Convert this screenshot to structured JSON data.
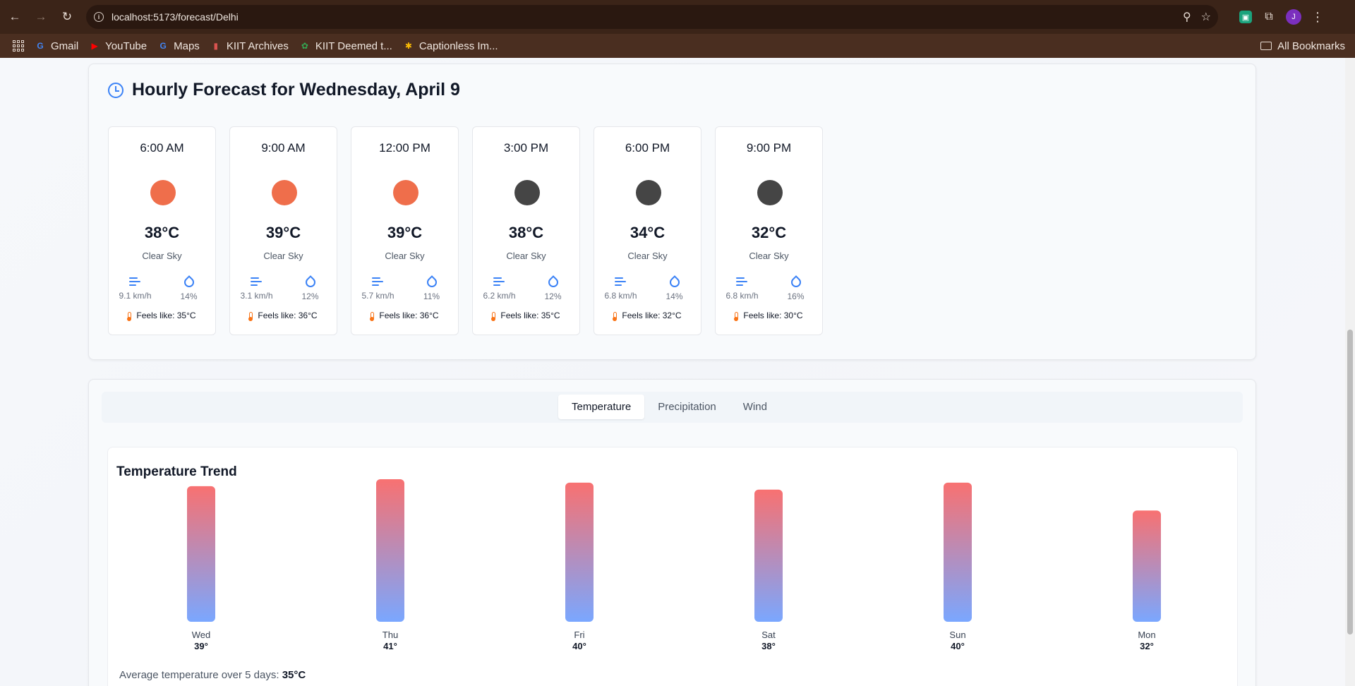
{
  "browser": {
    "url": "localhost:5173/forecast/Delhi",
    "avatar_initial": "J",
    "bookmarks": [
      {
        "label": "Gmail",
        "icon": "google-icon",
        "color": "#4285f4",
        "glyph": "G"
      },
      {
        "label": "YouTube",
        "icon": "youtube-icon",
        "color": "#ff0000",
        "glyph": "▶"
      },
      {
        "label": "Maps",
        "icon": "google-icon",
        "color": "#4285f4",
        "glyph": "G"
      },
      {
        "label": "KIIT Archives",
        "icon": "kiit-icon",
        "color": "#d9534f",
        "glyph": "▮"
      },
      {
        "label": "KIIT Deemed t...",
        "icon": "kiit-icon",
        "color": "#34a853",
        "glyph": "✿"
      },
      {
        "label": "Captionless Im...",
        "icon": "pinwheel-icon",
        "color": "#fbbc05",
        "glyph": "✱"
      }
    ],
    "all_bookmarks": "All Bookmarks"
  },
  "hourly": {
    "title": "Hourly Forecast for Wednesday, April 9",
    "items": [
      {
        "time": "6:00 AM",
        "temp": "38°C",
        "cond": "Clear Sky",
        "wind": "9.1 km/h",
        "humidity": "14%",
        "feels": "Feels like: 35°C",
        "icon": "sun-icon",
        "icon_color": "#ef6e4b"
      },
      {
        "time": "9:00 AM",
        "temp": "39°C",
        "cond": "Clear Sky",
        "wind": "3.1 km/h",
        "humidity": "12%",
        "feels": "Feels like: 36°C",
        "icon": "sun-icon",
        "icon_color": "#ef6e4b"
      },
      {
        "time": "12:00 PM",
        "temp": "39°C",
        "cond": "Clear Sky",
        "wind": "5.7 km/h",
        "humidity": "11%",
        "feels": "Feels like: 36°C",
        "icon": "sun-icon",
        "icon_color": "#ef6e4b"
      },
      {
        "time": "3:00 PM",
        "temp": "38°C",
        "cond": "Clear Sky",
        "wind": "6.2 km/h",
        "humidity": "12%",
        "feels": "Feels like: 35°C",
        "icon": "moon-icon",
        "icon_color": "#454545"
      },
      {
        "time": "6:00 PM",
        "temp": "34°C",
        "cond": "Clear Sky",
        "wind": "6.8 km/h",
        "humidity": "14%",
        "feels": "Feels like: 32°C",
        "icon": "moon-icon",
        "icon_color": "#454545"
      },
      {
        "time": "9:00 PM",
        "temp": "32°C",
        "cond": "Clear Sky",
        "wind": "6.8 km/h",
        "humidity": "16%",
        "feels": "Feels like: 30°C",
        "icon": "moon-icon",
        "icon_color": "#454545"
      }
    ]
  },
  "tabs": [
    "Temperature",
    "Precipitation",
    "Wind"
  ],
  "active_tab": "Temperature",
  "chart_data": {
    "type": "bar",
    "title": "Temperature Trend",
    "categories": [
      "Wed",
      "Thu",
      "Fri",
      "Sat",
      "Sun",
      "Mon"
    ],
    "values": [
      39,
      41,
      40,
      38,
      40,
      32
    ],
    "value_labels": [
      "39°",
      "41°",
      "40°",
      "38°",
      "40°",
      "32°"
    ],
    "gradient": [
      "#f87171",
      "#7aa7ff"
    ]
  },
  "summary": {
    "label": "Average temperature over 5 days:",
    "value": "35°C"
  }
}
